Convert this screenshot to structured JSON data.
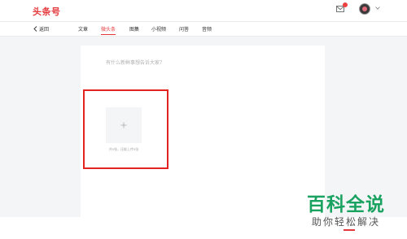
{
  "header": {
    "logo": "头条号",
    "icons": [
      "mail-icon",
      "avatar",
      "chevron-down-icon"
    ]
  },
  "nav": {
    "back_label": "返回",
    "tabs": [
      {
        "label": "文章",
        "active": false
      },
      {
        "label": "微头条",
        "active": true
      },
      {
        "label": "图集",
        "active": false
      },
      {
        "label": "小视频",
        "active": false
      },
      {
        "label": "问答",
        "active": false
      },
      {
        "label": "音频",
        "active": false
      }
    ]
  },
  "composer": {
    "placeholder": "有什么新鲜事想告诉大家？",
    "upload_hint": "共9张，还能上传9张"
  },
  "watermark": {
    "title": "百科全说",
    "subtitle": "助你轻松解决"
  },
  "colors": {
    "accent": "#e4393c",
    "highlight_box": "#e32222",
    "watermark_green": "#1aa260"
  }
}
